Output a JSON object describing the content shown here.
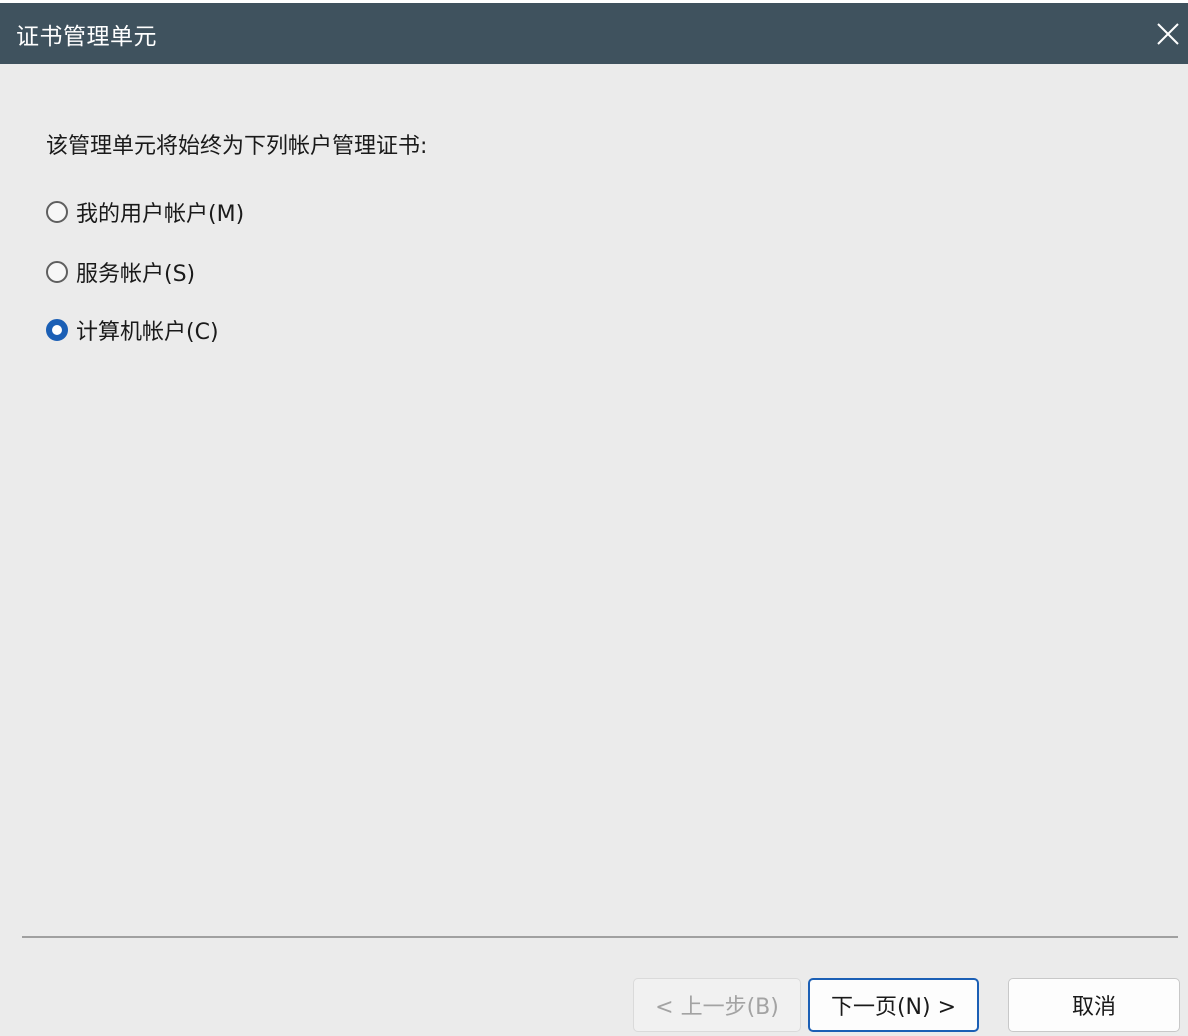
{
  "window": {
    "title": "证书管理单元"
  },
  "main": {
    "prompt": "该管理单元将始终为下列帐户管理证书:",
    "options": [
      {
        "label": "我的用户帐户(M)",
        "checked": false
      },
      {
        "label": "服务帐户(S)",
        "checked": false
      },
      {
        "label": "计算机帐户(C)",
        "checked": true
      }
    ]
  },
  "footer": {
    "back_label": "< 上一步(B)",
    "next_label": "下一页(N) >",
    "cancel_label": "取消"
  },
  "icons": {
    "close": "close-icon"
  },
  "colors": {
    "titlebar": "#3f525e",
    "accent": "#1b5fb5",
    "background": "#ebebeb"
  }
}
